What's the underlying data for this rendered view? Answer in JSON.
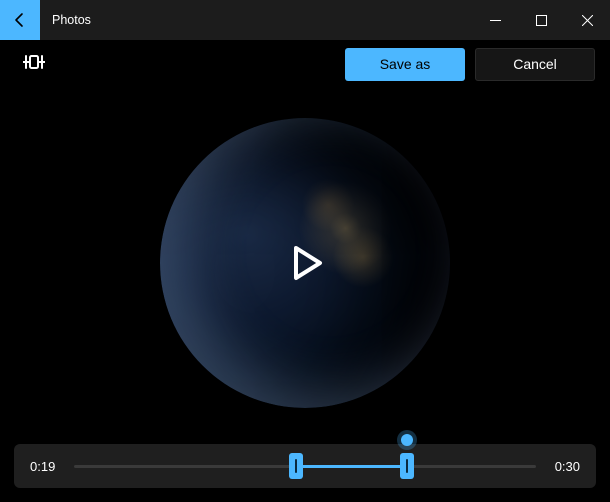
{
  "app": {
    "title": "Photos"
  },
  "toolbar": {
    "save_label": "Save as",
    "cancel_label": "Cancel"
  },
  "playback": {
    "current_time": "0:19",
    "total_time": "0:30",
    "trim_start_pct": 48,
    "trim_end_pct": 72,
    "playhead_pct": 72
  },
  "colors": {
    "accent": "#4cb7ff"
  }
}
